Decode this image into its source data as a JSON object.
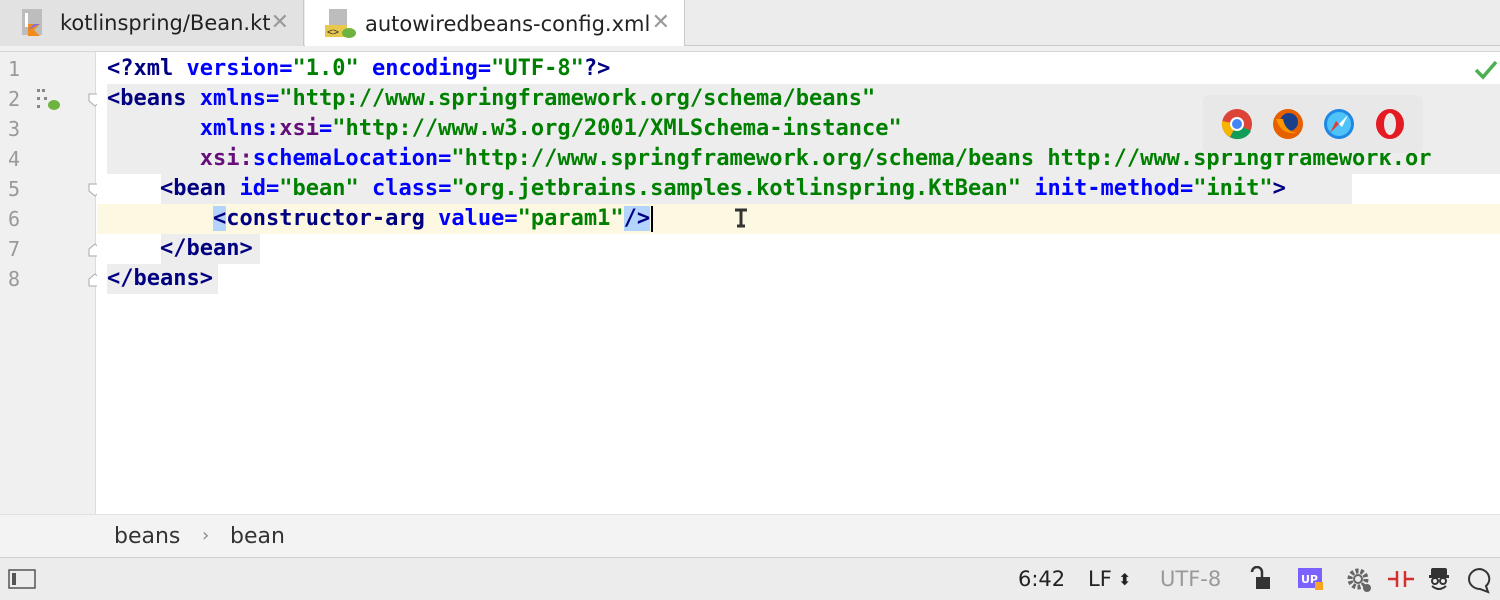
{
  "tabs": [
    {
      "label": "kotlinspring/Bean.kt",
      "close": "✕",
      "active": false,
      "icon": "kotlin-file-icon"
    },
    {
      "label": "autowiredbeans-config.xml",
      "close": "✕",
      "active": true,
      "icon": "spring-xml-file-icon"
    }
  ],
  "gutter": {
    "line_numbers": [
      "1",
      "2",
      "3",
      "4",
      "5",
      "6",
      "7",
      "8"
    ]
  },
  "code": {
    "line1": {
      "open": "<?",
      "name": "xml",
      "attr1": "version",
      "eq1": "=",
      "val1": "\"1.0\"",
      "attr2": "encoding",
      "eq2": "=",
      "val2": "\"UTF-8\"",
      "close": "?>"
    },
    "line2": {
      "tag": "<beans",
      "attr": "xmlns",
      "eq": "=",
      "val": "\"http://www.springframework.org/schema/beans\""
    },
    "line3": {
      "indent": "       ",
      "ns": "xmlns:",
      "attr": "xsi",
      "eq": "=",
      "val": "\"http://www.w3.org/2001/XMLSchema-instance\""
    },
    "line4": {
      "indent": "       ",
      "ns": "xsi:",
      "attr": "schemaLocation",
      "eq": "=",
      "val": "\"http://www.springframework.org/schema/beans http://www.springframework.or"
    },
    "line5": {
      "indent": "    ",
      "tag": "<bean",
      "attr1": "id",
      "eq1": "=",
      "val1": "\"bean\"",
      "attr2": "class",
      "eq2": "=",
      "val2": "\"org.jetbrains.samples.kotlinspring.KtBean\"",
      "attr3": "init-method",
      "eq3": "=",
      "val3": "\"init\"",
      "close": ">"
    },
    "line6": {
      "indent": "        ",
      "tag_lt": "<",
      "tag": "constructor-arg",
      "attr": "value",
      "eq": "=",
      "val": "\"param1\"",
      "selected": "/>"
    },
    "line7": {
      "indent": "    ",
      "tag": "</bean>"
    },
    "line8": {
      "tag": "</beans>"
    }
  },
  "browser_popup": {
    "icons": [
      "chrome-icon",
      "firefox-icon",
      "safari-icon",
      "opera-icon"
    ]
  },
  "breadcrumb": {
    "items": [
      "beans",
      "bean"
    ],
    "separator": "›"
  },
  "status": {
    "position": "6:42",
    "line_separator": "LF",
    "line_separator_arrow": "⬍",
    "encoding": "UTF-8"
  },
  "colors": {
    "tag": "#000080",
    "attribute": "#0000ff",
    "value": "#008000",
    "namespace": "#660e7a",
    "caret_line": "#fdf8e2",
    "selection": "#b3d4fc"
  }
}
